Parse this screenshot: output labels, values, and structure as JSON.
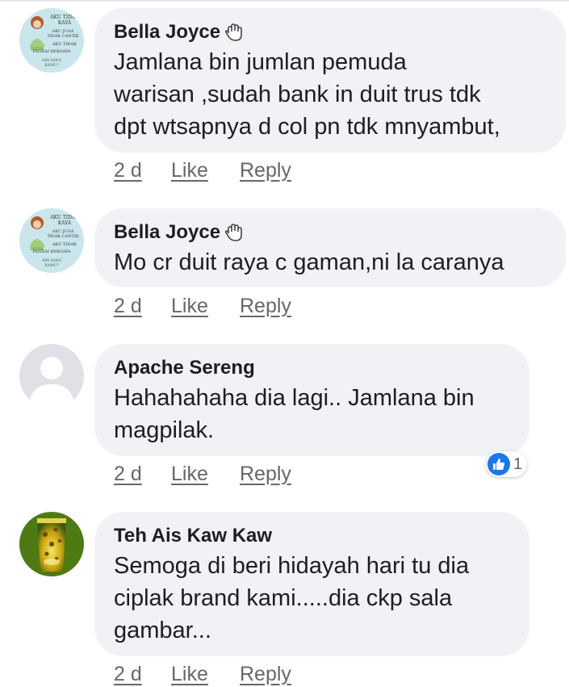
{
  "comments": [
    {
      "author": "Bella Joyce",
      "badge_icon": "waving-hand-icon",
      "avatar_icon": "cartoon-girl-avatar",
      "avatar_lines": [
        "AKU TIDAK",
        "KAYA",
        "AKU JUGA",
        "TIDAK CANTIK",
        "AKU TIDAK",
        "PANDAI BERGAYA",
        "APA YANG",
        "KAMU?"
      ],
      "text": "Jamlana bin jumlan pemuda\nwarisan ,sudah bank in duit trus tdk\ndpt wtsapnya d col pn tdk mnyambut,",
      "time": "2 d",
      "like_label": "Like",
      "reply_label": "Reply"
    },
    {
      "author": "Bella Joyce",
      "badge_icon": "waving-hand-icon",
      "avatar_icon": "cartoon-girl-avatar",
      "avatar_lines": [
        "AKU TIDAK",
        "KAYA",
        "AKU JUGA",
        "TIDAK CANTIK",
        "AKU TIDAK",
        "PANDAI BERGAYA",
        "APA YANG",
        "KAMU?"
      ],
      "text": "Mo cr duit raya c gaman,ni la caranya",
      "time": "2 d",
      "like_label": "Like",
      "reply_label": "Reply"
    },
    {
      "author": "Apache Sereng",
      "avatar_icon": "default-person-avatar",
      "text": "Hahahahaha dia lagi.. Jamlana bin\nmagpilak.",
      "time": "2 d",
      "like_label": "Like",
      "reply_label": "Reply",
      "reaction": {
        "icon": "thumbs-up-icon",
        "count": "1"
      }
    },
    {
      "author": "Teh Ais Kaw Kaw",
      "avatar_icon": "iced-tea-drink-avatar",
      "text": "Semoga di beri hidayah hari tu dia\nciplak brand kami.....dia ckp sala\ngambar...",
      "time": "2 d",
      "like_label": "Like",
      "reply_label": "Reply"
    }
  ],
  "colors": {
    "bubble": "#f0f2f5",
    "text": "#1c1e21",
    "meta": "#65676b",
    "like_blue": "#1877f2"
  }
}
